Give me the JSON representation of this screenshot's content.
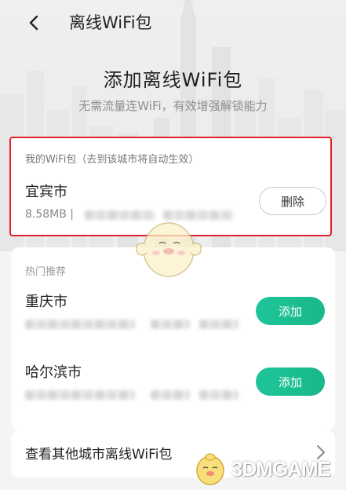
{
  "nav": {
    "title": "离线WiFi包",
    "back_icon": "chevron-left-icon"
  },
  "hero": {
    "title": "添加离线WiFi包",
    "subtitle": "无需流量连WiFi，有效增强解锁能力"
  },
  "my_packages": {
    "header": "我的WiFi包（去到该城市将自动生效）",
    "items": [
      {
        "city": "宜宾市",
        "size": "8.58MB |",
        "action_label": "删除"
      }
    ]
  },
  "hot": {
    "header": "热门推荐",
    "items": [
      {
        "city": "重庆市",
        "action_label": "添加"
      },
      {
        "city": "哈尔滨市",
        "action_label": "添加"
      }
    ]
  },
  "more": {
    "label": "查看其他城市离线WiFi包",
    "icon": "chevron-right-icon"
  },
  "watermark": {
    "text": "3DMGAME"
  },
  "colors": {
    "accent_green": "#1fc59a",
    "highlight_red": "#e0202a",
    "background": "#f4f4f4"
  }
}
